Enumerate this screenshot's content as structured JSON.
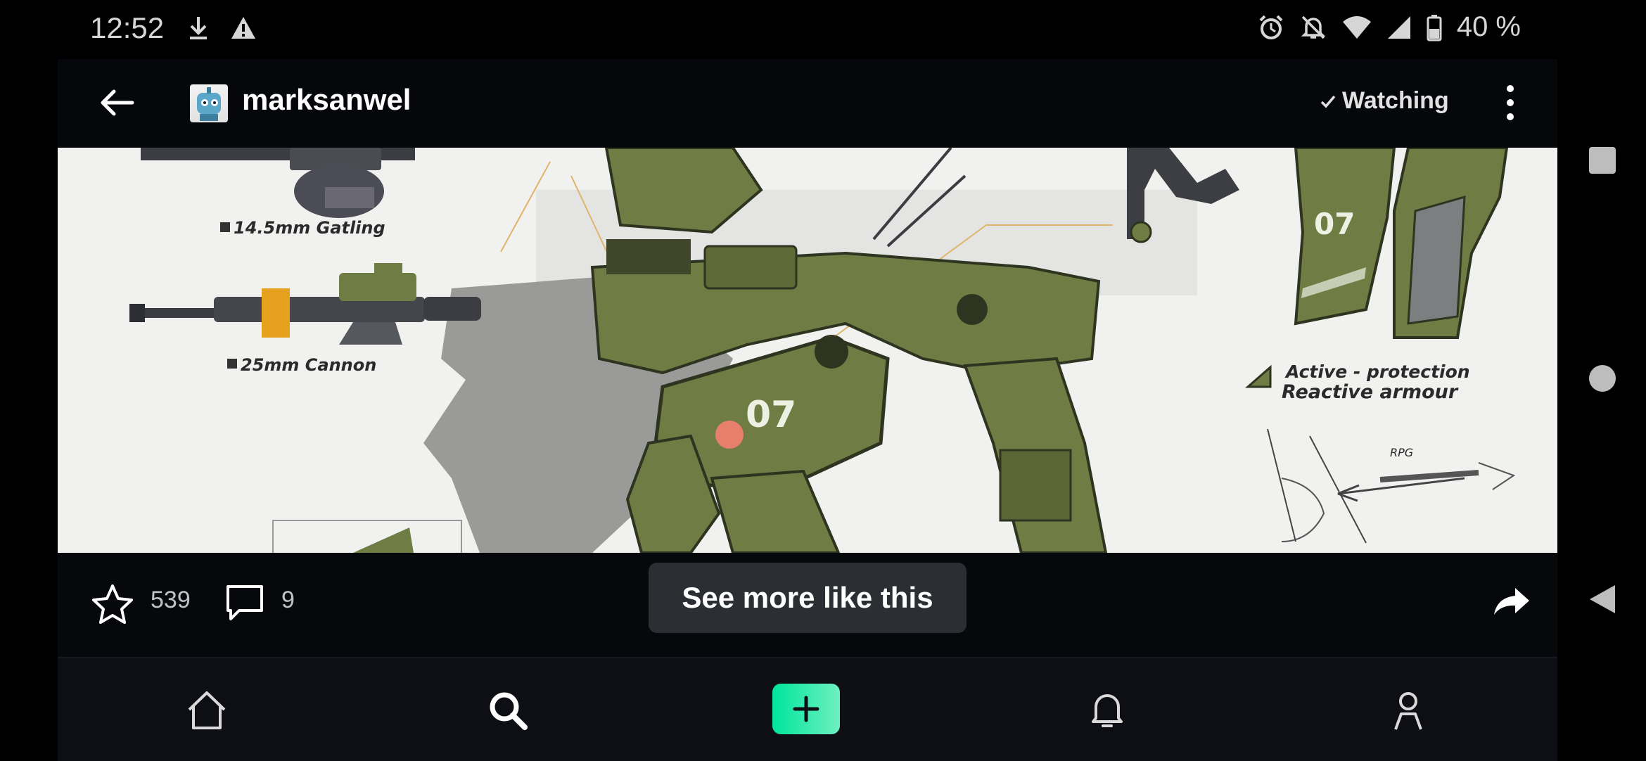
{
  "status_bar": {
    "time": "12:52",
    "battery_text": "40 %",
    "left_icons": [
      "download-icon",
      "warning-icon"
    ],
    "right_icons": [
      "alarm-icon",
      "notifications-off-icon",
      "wifi-icon",
      "cell-signal-icon",
      "battery-icon"
    ]
  },
  "header": {
    "username": "marksanwel",
    "watching_label": "Watching"
  },
  "artwork": {
    "labels": {
      "gatling": "14.5mm Gatling",
      "cannon": "25mm Cannon",
      "armour_line1": "Active - protection",
      "armour_line2": "Reactive armour",
      "unit_number": "07",
      "rpg": "RPG"
    }
  },
  "actions": {
    "favourites_count": "539",
    "comments_count": "9",
    "see_more_label": "See more like this"
  },
  "bottom_nav": {
    "items": [
      "home-icon",
      "search-icon",
      "create-icon",
      "notifications-icon",
      "profile-icon"
    ]
  },
  "colors": {
    "accent": "#00e59b",
    "background": "#07080c",
    "artwork_bg": "#f1f1ef",
    "mech_green": "#6f7d45"
  }
}
